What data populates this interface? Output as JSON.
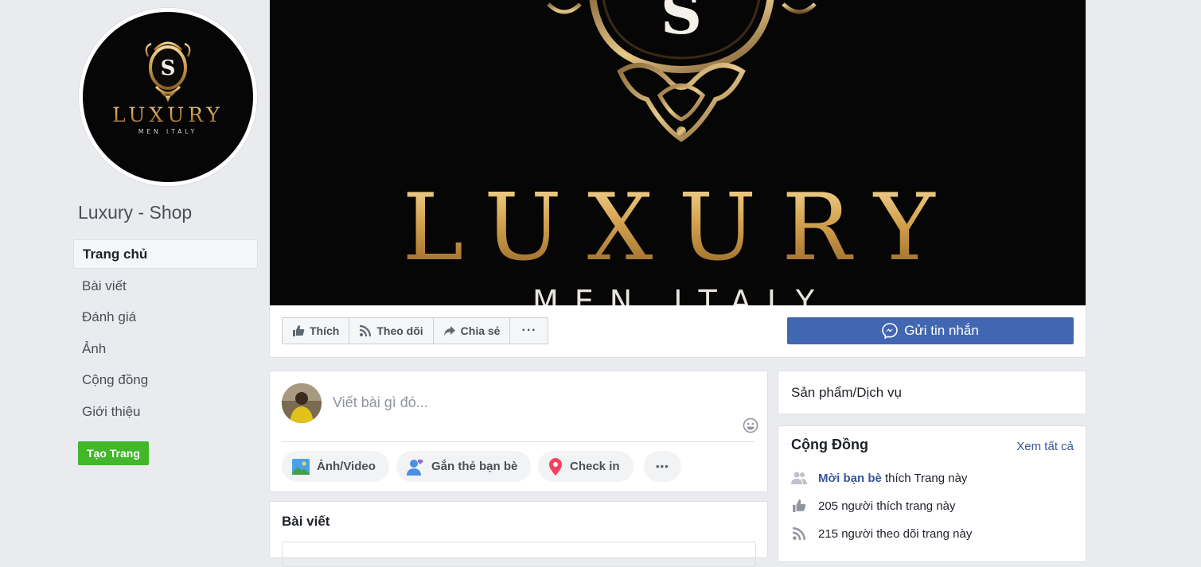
{
  "page": {
    "name": "Luxury - Shop",
    "logo": {
      "letter": "S",
      "brand": "LUXURY",
      "tagline": "MEN ITALY"
    }
  },
  "nav": {
    "items": [
      {
        "label": "Trang chủ",
        "active": true
      },
      {
        "label": "Bài viết"
      },
      {
        "label": "Đánh giá"
      },
      {
        "label": "Ảnh"
      },
      {
        "label": "Cộng đồng"
      },
      {
        "label": "Giới thiệu"
      }
    ],
    "create_page": "Tạo Trang"
  },
  "actions": {
    "like": "Thích",
    "follow": "Theo dõi",
    "share": "Chia sẻ",
    "more": "···",
    "send_message": "Gửi tin nhắn"
  },
  "composer": {
    "placeholder": "Viết bài gì đó...",
    "photo_video": "Ảnh/Video",
    "tag_friends": "Gắn thẻ bạn bè",
    "check_in": "Check in",
    "more": "•••"
  },
  "posts": {
    "title": "Bài viết"
  },
  "sidebar": {
    "products": "Sản phẩm/Dịch vụ",
    "community": {
      "title": "Cộng Đồng",
      "see_all": "Xem tất cả",
      "invite_link": "Mời bạn bè",
      "invite_rest": "thích Trang này",
      "likes": "205 người thích trang này",
      "follows": "215 người theo dõi trang này"
    }
  },
  "colors": {
    "facebook_blue": "#4267b2",
    "link_blue": "#385898",
    "green": "#42b72a",
    "gold": "#d9ac5c",
    "background": "#e9ebee"
  }
}
